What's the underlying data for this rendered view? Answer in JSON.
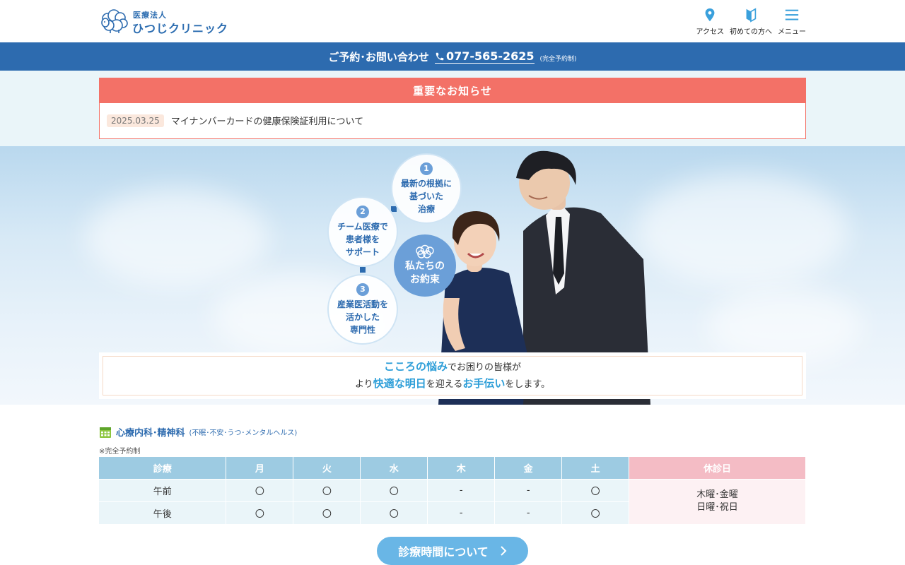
{
  "header": {
    "logo_sub": "医療法人",
    "logo_main": "ひつじクリニック",
    "nav": [
      {
        "label": "アクセス",
        "icon": "map-pin-icon"
      },
      {
        "label": "初めての方へ",
        "icon": "beginner-leaf-icon"
      },
      {
        "label": "メニュー",
        "icon": "hamburger-menu-icon"
      }
    ]
  },
  "telbar": {
    "label": "ご予約･お問い合わせ",
    "number": "077-565-2625",
    "note": "(完全予約制)"
  },
  "notice": {
    "heading": "重要なお知らせ",
    "items": [
      {
        "date": "2025.03.25",
        "text": "マイナンバーカードの健康保険証利用について"
      }
    ]
  },
  "hero": {
    "points": [
      {
        "num": "1",
        "text": "最新の根拠に\n基づいた\n治療"
      },
      {
        "num": "2",
        "text": "チーム医療で\n患者様を\nサポート"
      },
      {
        "num": "3",
        "text": "産業医活動を\n活かした\n専門性"
      }
    ],
    "promise": "私たちの\nお約束",
    "tagline": {
      "l1_hl": "こころの悩み",
      "l1_rest": "でお困りの皆様が",
      "l2_a": "より",
      "l2_hl1": "快適な明日",
      "l2_b": "を迎える",
      "l2_hl2": "お手伝い",
      "l2_c": "をします。"
    }
  },
  "schedule": {
    "title": "心療内科･精神科",
    "subtitle": "(不眠･不安･うつ･メンタルヘルス)",
    "note": "※完全予約制",
    "headers": [
      "診療",
      "月",
      "火",
      "水",
      "木",
      "金",
      "土",
      "休診日"
    ],
    "rows": [
      {
        "label": "午前",
        "cells": [
          "〇",
          "〇",
          "〇",
          "-",
          "-",
          "〇"
        ]
      },
      {
        "label": "午後",
        "cells": [
          "〇",
          "〇",
          "〇",
          "-",
          "-",
          "〇"
        ]
      }
    ],
    "holiday_l1": "木曜･金曜",
    "holiday_l2": "日曜･祝日"
  },
  "cta": {
    "label": "診療時間について"
  },
  "colors": {
    "brand": "#2d6baf",
    "notice": "#f37167",
    "table_head": "#9dcbe2",
    "holiday_head": "#f4bcc5",
    "cta": "#69b6e6"
  }
}
